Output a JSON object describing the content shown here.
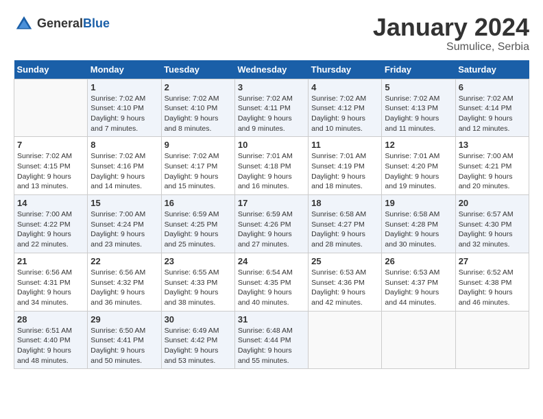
{
  "header": {
    "logo_general": "General",
    "logo_blue": "Blue",
    "month_title": "January 2024",
    "location": "Sumulice, Serbia"
  },
  "columns": [
    "Sunday",
    "Monday",
    "Tuesday",
    "Wednesday",
    "Thursday",
    "Friday",
    "Saturday"
  ],
  "weeks": [
    [
      {
        "day": "",
        "sunrise": "",
        "sunset": "",
        "daylight": ""
      },
      {
        "day": "1",
        "sunrise": "Sunrise: 7:02 AM",
        "sunset": "Sunset: 4:10 PM",
        "daylight": "Daylight: 9 hours and 7 minutes."
      },
      {
        "day": "2",
        "sunrise": "Sunrise: 7:02 AM",
        "sunset": "Sunset: 4:10 PM",
        "daylight": "Daylight: 9 hours and 8 minutes."
      },
      {
        "day": "3",
        "sunrise": "Sunrise: 7:02 AM",
        "sunset": "Sunset: 4:11 PM",
        "daylight": "Daylight: 9 hours and 9 minutes."
      },
      {
        "day": "4",
        "sunrise": "Sunrise: 7:02 AM",
        "sunset": "Sunset: 4:12 PM",
        "daylight": "Daylight: 9 hours and 10 minutes."
      },
      {
        "day": "5",
        "sunrise": "Sunrise: 7:02 AM",
        "sunset": "Sunset: 4:13 PM",
        "daylight": "Daylight: 9 hours and 11 minutes."
      },
      {
        "day": "6",
        "sunrise": "Sunrise: 7:02 AM",
        "sunset": "Sunset: 4:14 PM",
        "daylight": "Daylight: 9 hours and 12 minutes."
      }
    ],
    [
      {
        "day": "7",
        "sunrise": "Sunrise: 7:02 AM",
        "sunset": "Sunset: 4:15 PM",
        "daylight": "Daylight: 9 hours and 13 minutes."
      },
      {
        "day": "8",
        "sunrise": "Sunrise: 7:02 AM",
        "sunset": "Sunset: 4:16 PM",
        "daylight": "Daylight: 9 hours and 14 minutes."
      },
      {
        "day": "9",
        "sunrise": "Sunrise: 7:02 AM",
        "sunset": "Sunset: 4:17 PM",
        "daylight": "Daylight: 9 hours and 15 minutes."
      },
      {
        "day": "10",
        "sunrise": "Sunrise: 7:01 AM",
        "sunset": "Sunset: 4:18 PM",
        "daylight": "Daylight: 9 hours and 16 minutes."
      },
      {
        "day": "11",
        "sunrise": "Sunrise: 7:01 AM",
        "sunset": "Sunset: 4:19 PM",
        "daylight": "Daylight: 9 hours and 18 minutes."
      },
      {
        "day": "12",
        "sunrise": "Sunrise: 7:01 AM",
        "sunset": "Sunset: 4:20 PM",
        "daylight": "Daylight: 9 hours and 19 minutes."
      },
      {
        "day": "13",
        "sunrise": "Sunrise: 7:00 AM",
        "sunset": "Sunset: 4:21 PM",
        "daylight": "Daylight: 9 hours and 20 minutes."
      }
    ],
    [
      {
        "day": "14",
        "sunrise": "Sunrise: 7:00 AM",
        "sunset": "Sunset: 4:22 PM",
        "daylight": "Daylight: 9 hours and 22 minutes."
      },
      {
        "day": "15",
        "sunrise": "Sunrise: 7:00 AM",
        "sunset": "Sunset: 4:24 PM",
        "daylight": "Daylight: 9 hours and 23 minutes."
      },
      {
        "day": "16",
        "sunrise": "Sunrise: 6:59 AM",
        "sunset": "Sunset: 4:25 PM",
        "daylight": "Daylight: 9 hours and 25 minutes."
      },
      {
        "day": "17",
        "sunrise": "Sunrise: 6:59 AM",
        "sunset": "Sunset: 4:26 PM",
        "daylight": "Daylight: 9 hours and 27 minutes."
      },
      {
        "day": "18",
        "sunrise": "Sunrise: 6:58 AM",
        "sunset": "Sunset: 4:27 PM",
        "daylight": "Daylight: 9 hours and 28 minutes."
      },
      {
        "day": "19",
        "sunrise": "Sunrise: 6:58 AM",
        "sunset": "Sunset: 4:28 PM",
        "daylight": "Daylight: 9 hours and 30 minutes."
      },
      {
        "day": "20",
        "sunrise": "Sunrise: 6:57 AM",
        "sunset": "Sunset: 4:30 PM",
        "daylight": "Daylight: 9 hours and 32 minutes."
      }
    ],
    [
      {
        "day": "21",
        "sunrise": "Sunrise: 6:56 AM",
        "sunset": "Sunset: 4:31 PM",
        "daylight": "Daylight: 9 hours and 34 minutes."
      },
      {
        "day": "22",
        "sunrise": "Sunrise: 6:56 AM",
        "sunset": "Sunset: 4:32 PM",
        "daylight": "Daylight: 9 hours and 36 minutes."
      },
      {
        "day": "23",
        "sunrise": "Sunrise: 6:55 AM",
        "sunset": "Sunset: 4:33 PM",
        "daylight": "Daylight: 9 hours and 38 minutes."
      },
      {
        "day": "24",
        "sunrise": "Sunrise: 6:54 AM",
        "sunset": "Sunset: 4:35 PM",
        "daylight": "Daylight: 9 hours and 40 minutes."
      },
      {
        "day": "25",
        "sunrise": "Sunrise: 6:53 AM",
        "sunset": "Sunset: 4:36 PM",
        "daylight": "Daylight: 9 hours and 42 minutes."
      },
      {
        "day": "26",
        "sunrise": "Sunrise: 6:53 AM",
        "sunset": "Sunset: 4:37 PM",
        "daylight": "Daylight: 9 hours and 44 minutes."
      },
      {
        "day": "27",
        "sunrise": "Sunrise: 6:52 AM",
        "sunset": "Sunset: 4:38 PM",
        "daylight": "Daylight: 9 hours and 46 minutes."
      }
    ],
    [
      {
        "day": "28",
        "sunrise": "Sunrise: 6:51 AM",
        "sunset": "Sunset: 4:40 PM",
        "daylight": "Daylight: 9 hours and 48 minutes."
      },
      {
        "day": "29",
        "sunrise": "Sunrise: 6:50 AM",
        "sunset": "Sunset: 4:41 PM",
        "daylight": "Daylight: 9 hours and 50 minutes."
      },
      {
        "day": "30",
        "sunrise": "Sunrise: 6:49 AM",
        "sunset": "Sunset: 4:42 PM",
        "daylight": "Daylight: 9 hours and 53 minutes."
      },
      {
        "day": "31",
        "sunrise": "Sunrise: 6:48 AM",
        "sunset": "Sunset: 4:44 PM",
        "daylight": "Daylight: 9 hours and 55 minutes."
      },
      {
        "day": "",
        "sunrise": "",
        "sunset": "",
        "daylight": ""
      },
      {
        "day": "",
        "sunrise": "",
        "sunset": "",
        "daylight": ""
      },
      {
        "day": "",
        "sunrise": "",
        "sunset": "",
        "daylight": ""
      }
    ]
  ]
}
